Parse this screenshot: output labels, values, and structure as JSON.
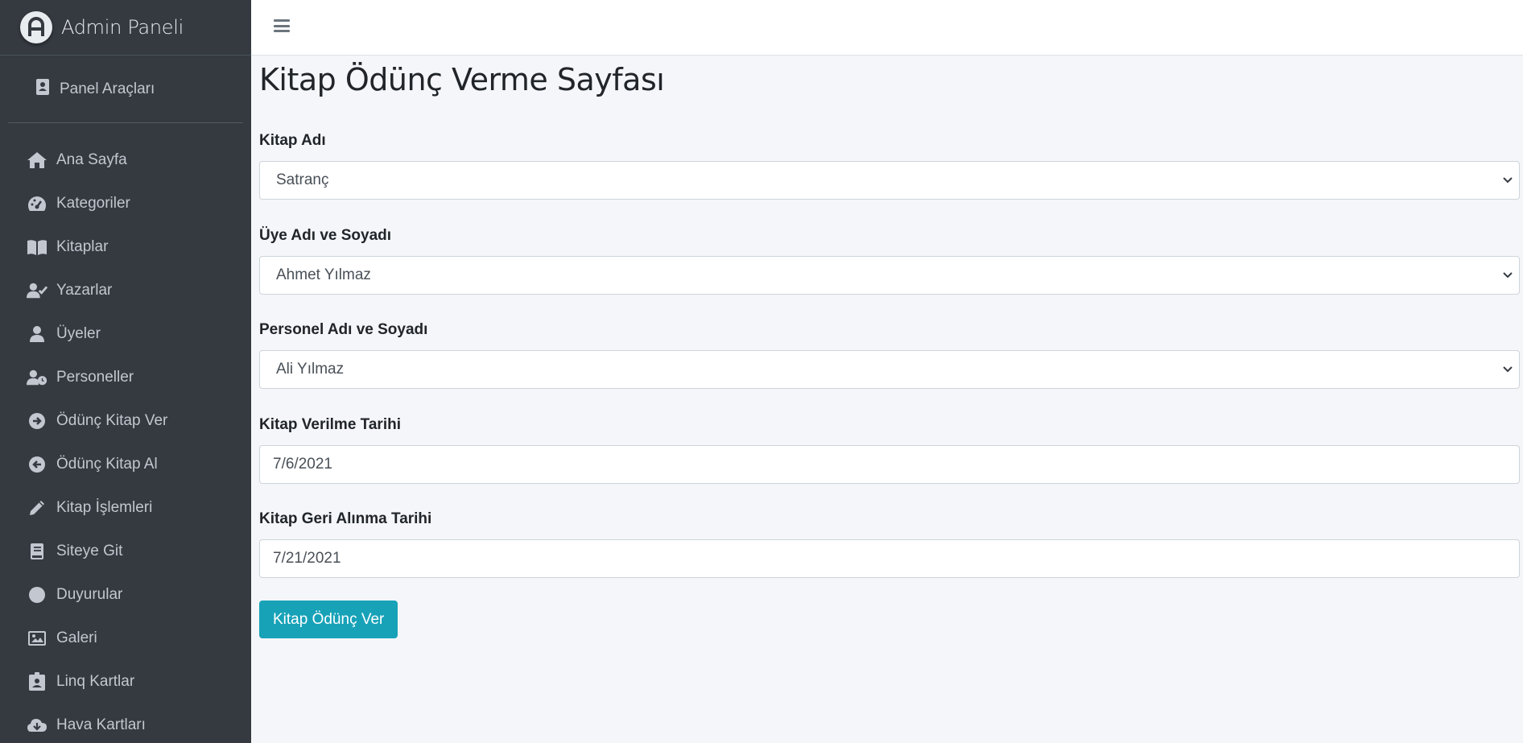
{
  "brand": {
    "title": "Admin Paneli",
    "logo_letter": "A"
  },
  "panel_tools": {
    "label": "Panel Araçları",
    "icon": "address-book-icon"
  },
  "nav": [
    {
      "label": "Ana Sayfa",
      "icon": "home-icon"
    },
    {
      "label": "Kategoriler",
      "icon": "tachometer-icon"
    },
    {
      "label": "Kitaplar",
      "icon": "book-open-icon"
    },
    {
      "label": "Yazarlar",
      "icon": "user-check-icon"
    },
    {
      "label": "Üyeler",
      "icon": "user-icon"
    },
    {
      "label": "Personeller",
      "icon": "user-clock-icon"
    },
    {
      "label": "Ödünç Kitap Ver",
      "icon": "arrow-circle-right-icon"
    },
    {
      "label": "Ödünç Kitap Al",
      "icon": "arrow-circle-left-icon"
    },
    {
      "label": "Kitap İşlemleri",
      "icon": "pencil-icon"
    },
    {
      "label": "Siteye Git",
      "icon": "book-icon"
    },
    {
      "label": "Duyurular",
      "icon": "circle-icon"
    },
    {
      "label": "Galeri",
      "icon": "image-icon"
    },
    {
      "label": "Linq Kartlar",
      "icon": "id-badge-icon"
    },
    {
      "label": "Hava Kartları",
      "icon": "cloud-download-icon"
    }
  ],
  "page": {
    "title": "Kitap Ödünç Verme Sayfası",
    "fields": {
      "book": {
        "label": "Kitap Adı",
        "value": "Satranç"
      },
      "member": {
        "label": "Üye Adı ve Soyadı",
        "value": "Ahmet Yılmaz"
      },
      "staff": {
        "label": "Personel Adı ve Soyadı",
        "value": "Ali Yılmaz"
      },
      "lend_date": {
        "label": "Kitap Verilme Tarihi",
        "value": "7/6/2021"
      },
      "return_date": {
        "label": "Kitap Geri Alınma Tarihi",
        "value": "7/21/2021"
      }
    },
    "submit_label": "Kitap Ödünç Ver"
  },
  "colors": {
    "sidebar_bg": "#343a40",
    "accent": "#17a2b8",
    "page_bg": "#f4f6f9"
  }
}
